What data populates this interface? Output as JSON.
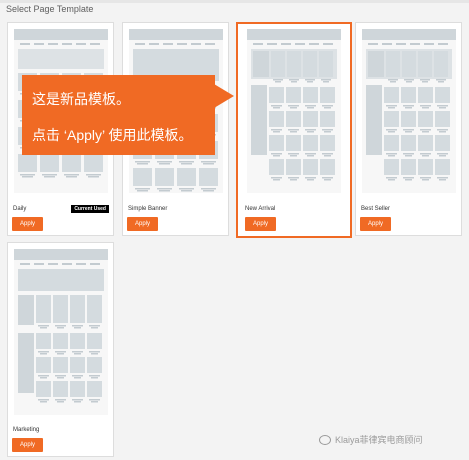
{
  "header": {
    "title": "Select Page Template"
  },
  "templates": [
    {
      "name": "Daily",
      "apply_label": "Apply",
      "badge": "Current Used"
    },
    {
      "name": "Simple Banner",
      "apply_label": "Apply"
    },
    {
      "name": "New Arrival",
      "apply_label": "Apply"
    },
    {
      "name": "Best Seller",
      "apply_label": "Apply"
    },
    {
      "name": "Marketing",
      "apply_label": "Apply"
    }
  ],
  "callout": {
    "line1": "这是新品模板。",
    "line2": "点击 ‘Apply’ 使用此模板。"
  },
  "watermark": {
    "text": "Klaiya菲律宾电商顾问"
  },
  "colors": {
    "accent": "#f06a24",
    "badge_bg": "#000000"
  }
}
